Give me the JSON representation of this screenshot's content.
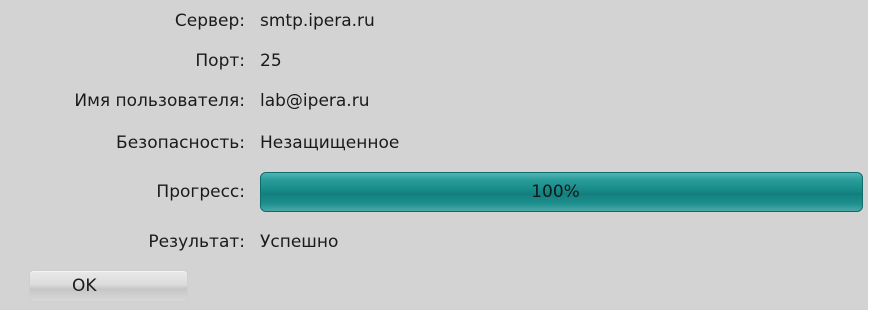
{
  "fields": {
    "server": {
      "label": "Сервер:",
      "value": "smtp.ipera.ru"
    },
    "port": {
      "label": "Порт:",
      "value": "25"
    },
    "username": {
      "label": "Имя пользователя:",
      "value": "lab@ipera.ru"
    },
    "security": {
      "label": "Безопасность:",
      "value": "Незащищенное"
    },
    "progress": {
      "label": "Прогресс:",
      "text": "100%",
      "percent": 100
    },
    "result": {
      "label": "Результат:",
      "value": "Успешно"
    }
  },
  "buttons": {
    "ok_label": "OK"
  },
  "colors": {
    "dialog_background": "#d3d3d3",
    "progress_fill": "#178987"
  }
}
